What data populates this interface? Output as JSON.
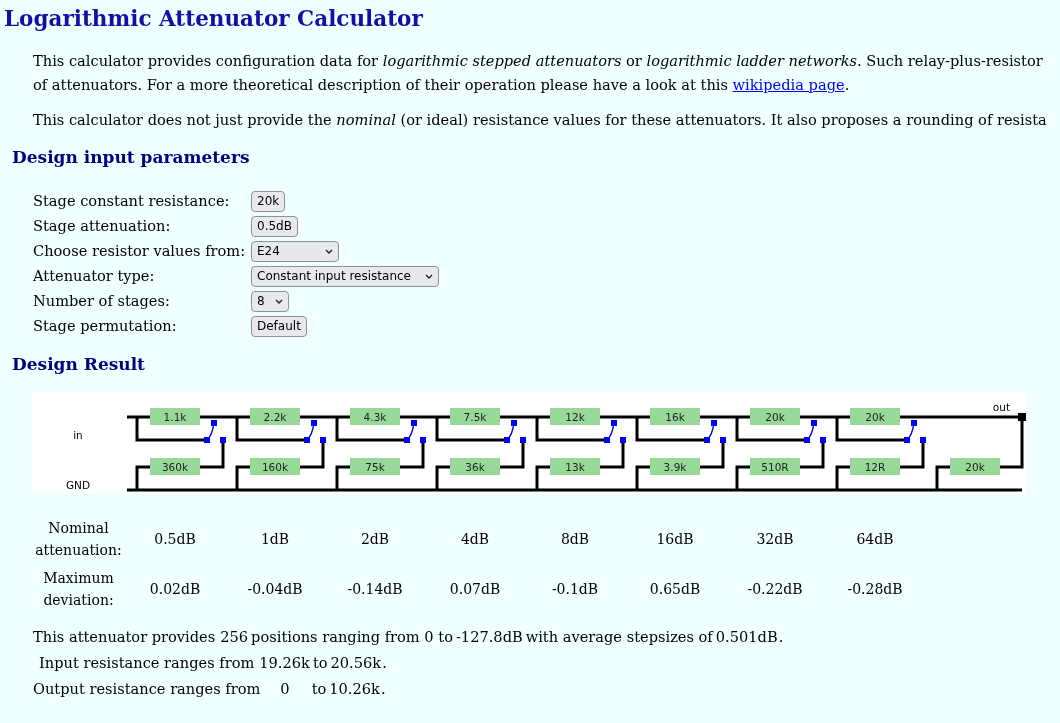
{
  "title": "Logarithmic Attenuator Calculator",
  "intro_line1": "This calculator provides configuration data for *logarithmic stepped attenuators* or *logarithmic ladder networks*. Such relay-plus-resistor",
  "intro_line2": {
    "before": "of attenuators. For a more theoretical description of their operation please have a look at this",
    "link": "wikipedia page",
    "after": "."
  },
  "intro2": "This calculator does not just provide the *nominal* (or ideal) resistance values for these attenuators. It also proposes a rounding of resista",
  "input_heading": "Design input parameters",
  "inputs": [
    {
      "label": "Stage constant resistance:",
      "kind": "button",
      "value": "20k"
    },
    {
      "label": "Stage attenuation:",
      "kind": "button",
      "value": "0.5dB"
    },
    {
      "label": "Choose resistor values from:",
      "kind": "select",
      "value": "E24"
    },
    {
      "label": "Attenuator type:",
      "kind": "select",
      "value": "Constant input resistance"
    },
    {
      "label": "Number of stages:",
      "kind": "select",
      "value": "8"
    },
    {
      "label": "Stage permutation:",
      "kind": "button",
      "value": "Default"
    }
  ],
  "result_heading": "Design Result",
  "circuit": {
    "in_label": "in",
    "gnd_label": "GND",
    "out_label": "out",
    "stages": [
      {
        "series": "1.1k",
        "shunt": "360k"
      },
      {
        "series": "2.2k",
        "shunt": "160k"
      },
      {
        "series": "4.3k",
        "shunt": "75k"
      },
      {
        "series": "7.5k",
        "shunt": "36k"
      },
      {
        "series": "12k",
        "shunt": "13k"
      },
      {
        "series": "16k",
        "shunt": "3.9k"
      },
      {
        "series": "20k",
        "shunt": "510R"
      },
      {
        "series": "20k",
        "shunt": "12R"
      }
    ],
    "load": "20k"
  },
  "table": [
    {
      "label": "Nominal attenuation:",
      "values": [
        "0.5dB",
        "1dB",
        "2dB",
        "4dB",
        "8dB",
        "16dB",
        "32dB",
        "64dB"
      ]
    },
    {
      "label": "Maximum deviation:",
      "values": [
        "0.02dB",
        "-0.04dB",
        "-0.14dB",
        "0.07dB",
        "-0.1dB",
        "0.65dB",
        "-0.22dB",
        "-0.28dB"
      ]
    }
  ],
  "summary": [
    {
      "parts": [
        {
          "text": "This attenuator provides"
        },
        {
          "text": "256",
          "kind": "value"
        },
        {
          "text": "positions ranging from 0 to"
        },
        {
          "text": "-127.8dB",
          "kind": "value"
        },
        {
          "text": "with average stepsizes of"
        },
        {
          "text": "0.501dB",
          "kind": "value"
        },
        {
          "text": "."
        }
      ]
    },
    {
      "parts": [
        {
          "text": "Input resistance ranges from"
        },
        {
          "text": "19.26k",
          "kind": "value"
        },
        {
          "text": "to"
        },
        {
          "text": "20.56k",
          "kind": "value"
        },
        {
          "text": "."
        }
      ]
    },
    {
      "parts": [
        {
          "text": "Output resistance ranges from"
        },
        {
          "text": "0",
          "kind": "wide"
        },
        {
          "text": "to"
        },
        {
          "text": "10.26k",
          "kind": "value"
        },
        {
          "text": "."
        }
      ]
    }
  ]
}
